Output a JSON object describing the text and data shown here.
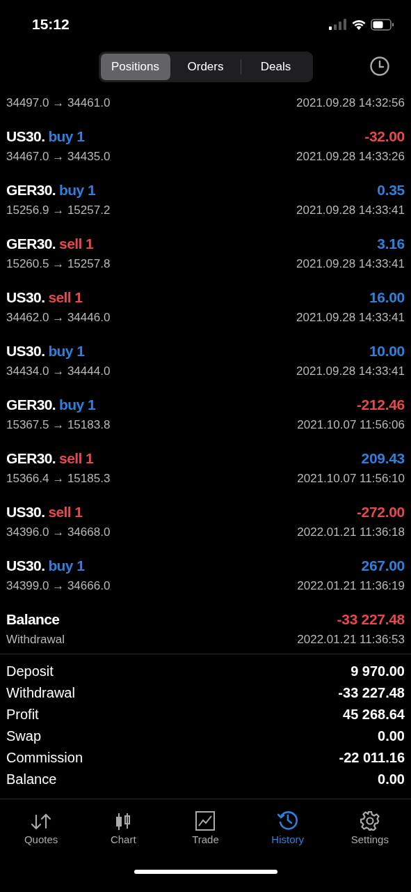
{
  "status_bar": {
    "time": "15:12"
  },
  "segments": [
    {
      "label": "Positions",
      "selected": true
    },
    {
      "label": "Orders",
      "selected": false
    },
    {
      "label": "Deals",
      "selected": false
    }
  ],
  "deals": [
    {
      "prices": "34497.0 → 34461.0",
      "time": "2021.09.28 14:32:56"
    },
    {
      "symbol": "US30.",
      "side": {
        "text": "buy 1",
        "color": "#2f7fdc"
      },
      "profit": {
        "text": "-32.00",
        "color": "#e5484d"
      },
      "prices": "34467.0 → 34435.0",
      "time": "2021.09.28 14:33:26"
    },
    {
      "symbol": "GER30.",
      "side": {
        "text": "buy 1",
        "color": "#2f7fdc"
      },
      "profit": {
        "text": "0.35",
        "color": "#2f7fdc"
      },
      "prices": "15256.9 → 15257.2",
      "time": "2021.09.28 14:33:41"
    },
    {
      "symbol": "GER30.",
      "side": {
        "text": "sell 1",
        "color": "#e5484d"
      },
      "profit": {
        "text": "3.16",
        "color": "#2f7fdc"
      },
      "prices": "15260.5 → 15257.8",
      "time": "2021.09.28 14:33:41"
    },
    {
      "symbol": "US30.",
      "side": {
        "text": "sell 1",
        "color": "#e5484d"
      },
      "profit": {
        "text": "16.00",
        "color": "#2f7fdc"
      },
      "prices": "34462.0 → 34446.0",
      "time": "2021.09.28 14:33:41"
    },
    {
      "symbol": "US30.",
      "side": {
        "text": "buy 1",
        "color": "#2f7fdc"
      },
      "profit": {
        "text": "10.00",
        "color": "#2f7fdc"
      },
      "prices": "34434.0 → 34444.0",
      "time": "2021.09.28 14:33:41"
    },
    {
      "symbol": "GER30.",
      "side": {
        "text": "buy 1",
        "color": "#2f7fdc"
      },
      "profit": {
        "text": "-212.46",
        "color": "#e5484d"
      },
      "prices": "15367.5 → 15183.8",
      "time": "2021.10.07 11:56:06"
    },
    {
      "symbol": "GER30.",
      "side": {
        "text": "sell 1",
        "color": "#e5484d"
      },
      "profit": {
        "text": "209.43",
        "color": "#2f7fdc"
      },
      "prices": "15366.4 → 15185.3",
      "time": "2021.10.07 11:56:10"
    },
    {
      "symbol": "US30.",
      "side": {
        "text": "sell 1",
        "color": "#e5484d"
      },
      "profit": {
        "text": "-272.00",
        "color": "#e5484d"
      },
      "prices": "34396.0 → 34668.0",
      "time": "2022.01.21 11:36:18"
    },
    {
      "symbol": "US30.",
      "side": {
        "text": "buy 1",
        "color": "#2f7fdc"
      },
      "profit": {
        "text": "267.00",
        "color": "#2f7fdc"
      },
      "prices": "34399.0 → 34666.0",
      "time": "2022.01.21 11:36:19"
    },
    {
      "symbol": "Balance",
      "profit": {
        "text": "-33 227.48",
        "color": "#e5484d"
      },
      "comment": "Withdrawal",
      "time": "2022.01.21 11:36:53"
    }
  ],
  "summary": [
    {
      "label": "Deposit",
      "value": "9 970.00"
    },
    {
      "label": "Withdrawal",
      "value": "-33 227.48"
    },
    {
      "label": "Profit",
      "value": "45 268.64"
    },
    {
      "label": "Swap",
      "value": "0.00"
    },
    {
      "label": "Commission",
      "value": "-22 011.16"
    },
    {
      "label": "Balance",
      "value": "0.00"
    }
  ],
  "tab_bar": [
    {
      "kind": "quotes",
      "label": "Quotes",
      "selected": false
    },
    {
      "kind": "chart",
      "label": "Chart",
      "selected": false
    },
    {
      "kind": "trade",
      "label": "Trade",
      "selected": false
    },
    {
      "kind": "history",
      "label": "History",
      "selected": true
    },
    {
      "kind": "settings",
      "label": "Settings",
      "selected": false
    }
  ]
}
